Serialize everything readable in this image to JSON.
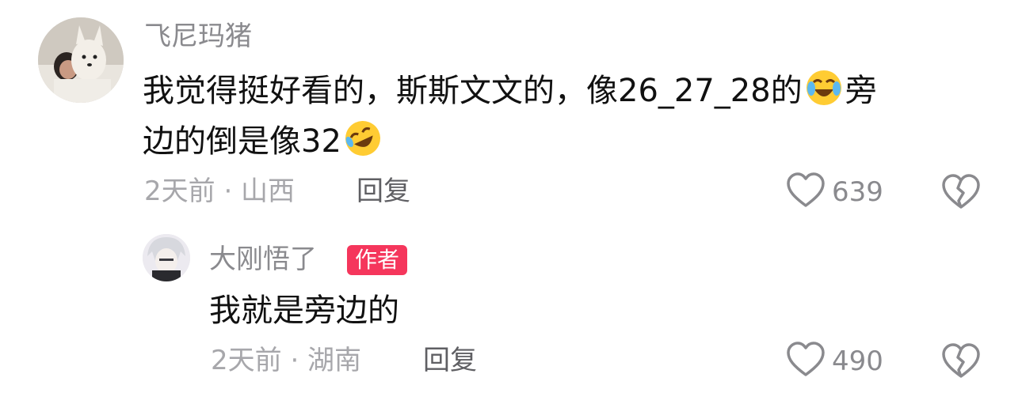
{
  "comments": [
    {
      "username": "飞尼玛猪",
      "text_line1_part1": "我觉得挺好看的，斯斯文文的，像26_27_28的",
      "text_line1_part2": "旁",
      "text_line2": "边的倒是像32",
      "emoji1": "laughing-crying-emoji",
      "emoji2": "rofl-emoji",
      "time_location": "2天前 · 山西",
      "reply_label": "回复",
      "likes": "639"
    },
    {
      "username": "大刚悟了",
      "badge": "作者",
      "text": "我就是旁边的",
      "time_location": "2天前 · 湖南",
      "reply_label": "回复",
      "likes": "490"
    }
  ],
  "icons": {
    "heart": "heart-outline-icon",
    "broken_heart": "broken-heart-icon"
  },
  "colors": {
    "badge": "#f5365c",
    "muted": "#8a8a8e",
    "text": "#111111"
  }
}
